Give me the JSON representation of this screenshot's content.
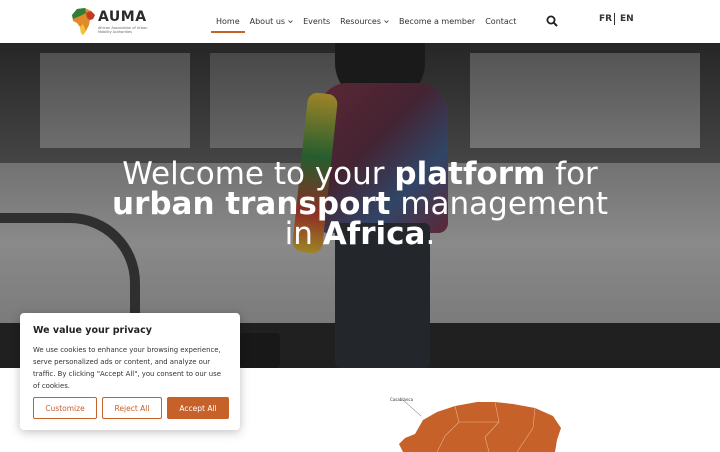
{
  "brand": {
    "name": "AUMA",
    "tagline": "African Association of Urban Mobility Authorities",
    "accent": "#c7612a"
  },
  "nav": {
    "items": [
      {
        "label": "Home",
        "active": true,
        "dropdown": false
      },
      {
        "label": "About us",
        "active": false,
        "dropdown": true
      },
      {
        "label": "Events",
        "active": false,
        "dropdown": false
      },
      {
        "label": "Resources",
        "active": false,
        "dropdown": true
      },
      {
        "label": "Become a member",
        "active": false,
        "dropdown": false
      },
      {
        "label": "Contact",
        "active": false,
        "dropdown": false
      }
    ],
    "search_icon": "search-icon",
    "languages": [
      "FR",
      "EN"
    ]
  },
  "hero": {
    "line1_a": "Welcome to your ",
    "line1_b": "platform",
    "line1_c": " for",
    "line2_a": "urban transport",
    "line2_b": " management",
    "line3_a": "in ",
    "line3_b": "Africa",
    "line3_c": "."
  },
  "cookie": {
    "title": "We value your privacy",
    "text": "We use cookies to enhance your browsing experience, serve personalized ads or content, and analyze our traffic. By clicking \"Accept All\", you consent to our use of cookies.",
    "customize": "Customize",
    "reject": "Reject All",
    "accept": "Accept All"
  },
  "map": {
    "label": "Casablanca"
  }
}
